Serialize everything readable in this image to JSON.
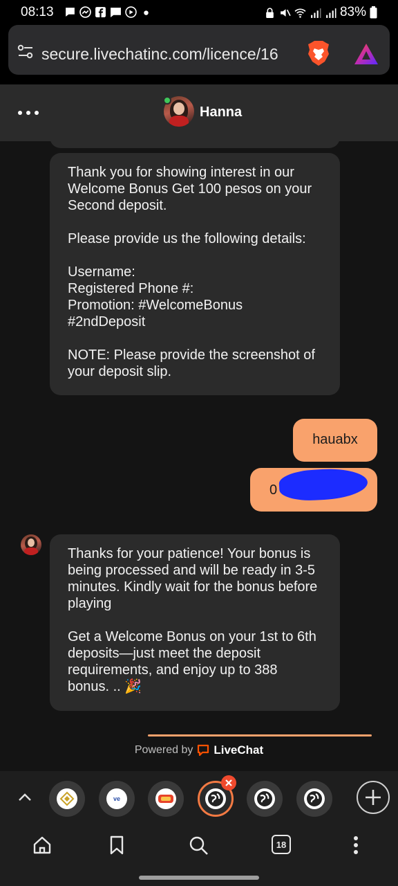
{
  "status_bar": {
    "time": "08:13",
    "battery": "83%",
    "notification_icons": [
      "chat-bubble-icon",
      "messenger-icon",
      "facebook-icon",
      "message-icon",
      "play-icon",
      "dot-icon"
    ],
    "system_icons": [
      "lock-icon",
      "mute-icon",
      "wifi-icon",
      "signal-icon",
      "signal-icon",
      "battery-icon"
    ]
  },
  "browser": {
    "url": "secure.livechatinc.com/licence/16",
    "tab_count": "18",
    "tabs": [
      {
        "icon": "site-logo-icon",
        "label": ""
      },
      {
        "icon": "site-logo-icon",
        "label": "ve"
      },
      {
        "icon": "site-logo-icon",
        "label": ""
      },
      {
        "icon": "globe-icon",
        "label": "",
        "active": true
      },
      {
        "icon": "globe-icon",
        "label": ""
      },
      {
        "icon": "globe-icon",
        "label": ""
      }
    ],
    "accent_color": "#f37a43"
  },
  "chat": {
    "agent_name": "Hanna",
    "agent_status": "online",
    "messages": [
      {
        "from": "agent",
        "text": "Thank you for showing interest in our Welcome Bonus Get 100 pesos on your Second deposit.\n\nPlease provide us the following details:\n\nUsername:\nRegistered Phone #:\nPromotion: #WelcomeBonus #2ndDeposit\n\nNOTE: Please provide the screenshot of your deposit slip."
      },
      {
        "from": "user",
        "text": "hauabx"
      },
      {
        "from": "user",
        "text": "0"
      },
      {
        "from": "agent",
        "text": "Thanks for your patience! Your bonus is being processed and will be ready in 3-5 minutes. Kindly wait for the bonus before playing\n\nGet a Welcome Bonus on your 1st to 6th deposits—just meet the deposit requirements, and enjoy up to 388 bonus. .. 🎉"
      }
    ],
    "user_bubble_color": "#f9a26c",
    "agent_bubble_color": "#2b2b2b"
  },
  "footer": {
    "powered_by": "Powered by",
    "brand": "LiveChat"
  }
}
